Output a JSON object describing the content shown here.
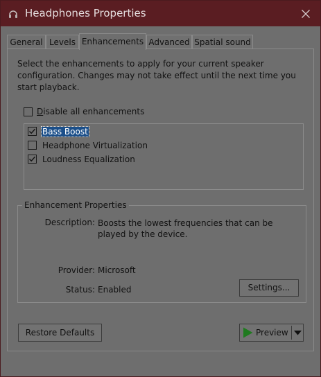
{
  "window": {
    "title": "Headphones Properties",
    "close_label": "×",
    "app_icon": "headphones-icon"
  },
  "tabs": [
    {
      "label": "General",
      "active": false
    },
    {
      "label": "Levels",
      "active": false
    },
    {
      "label": "Enhancements",
      "active": true
    },
    {
      "label": "Advanced",
      "active": false
    },
    {
      "label": "Spatial sound",
      "active": false
    }
  ],
  "intro_text": "Select the enhancements to apply for your current speaker configuration. Changes may not take effect until the next time you start playback.",
  "disable_all": {
    "label": "Disable all enhancements",
    "checked": false
  },
  "enhancements": [
    {
      "label": "Bass Boost",
      "checked": true,
      "selected": true
    },
    {
      "label": "Headphone Virtualization",
      "checked": false,
      "selected": false
    },
    {
      "label": "Loudness Equalization",
      "checked": true,
      "selected": false
    }
  ],
  "properties": {
    "title": "Enhancement Properties",
    "description_label": "Description:",
    "description_value": "Boosts the lowest frequencies that can be played by the device.",
    "provider_label": "Provider:",
    "provider_value": "Microsoft",
    "status_label": "Status:",
    "status_value": "Enabled",
    "settings_button": "Settings..."
  },
  "footer": {
    "restore_defaults": "Restore Defaults",
    "preview": "Preview"
  },
  "colors": {
    "titlebar": "#5a1d22",
    "selection": "#1b4f8a",
    "preview_arrow": "#1f7a1f"
  }
}
